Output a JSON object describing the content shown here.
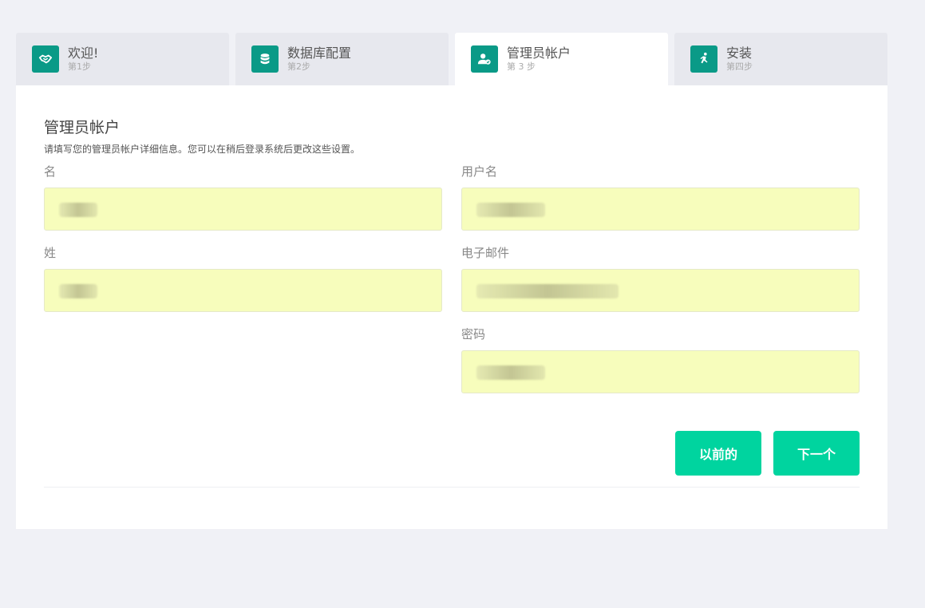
{
  "steps": [
    {
      "title": "欢迎!",
      "sub": "第1步",
      "icon": "handshake-icon"
    },
    {
      "title": "数据库配置",
      "sub": "第2步",
      "icon": "database-icon"
    },
    {
      "title": "管理员帐户",
      "sub": "第 3 步",
      "icon": "admin-user-icon"
    },
    {
      "title": "安装",
      "sub": "第四步",
      "icon": "running-person-icon"
    }
  ],
  "active_step": 3,
  "accent_color": "#0a9a87",
  "button_color": "#00d49f",
  "autofill_color": "#f7fdbc",
  "section": {
    "title": "管理员帐户",
    "description": "请填写您的管理员帐户详细信息。您可以在稍后登录系统后更改这些设置。"
  },
  "fields": {
    "first_name": {
      "label": "名",
      "value": ""
    },
    "last_name": {
      "label": "姓",
      "value": ""
    },
    "username": {
      "label": "用户名",
      "value": ""
    },
    "email": {
      "label": "电子邮件",
      "value": ""
    },
    "password": {
      "label": "密码",
      "value": ""
    }
  },
  "buttons": {
    "prev": "以前的",
    "next": "下一个"
  }
}
